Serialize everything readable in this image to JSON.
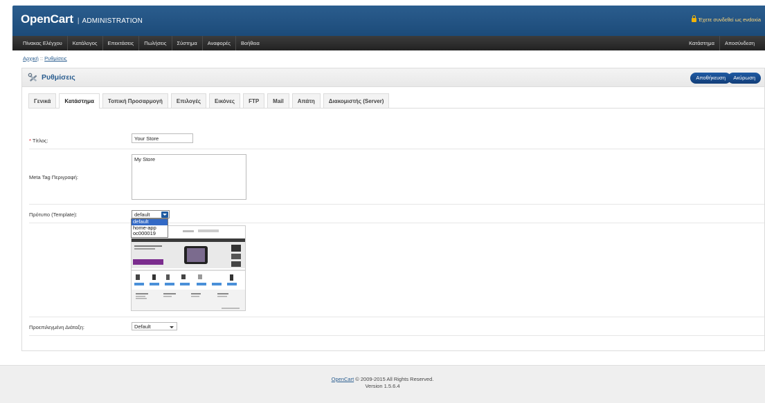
{
  "header": {
    "brand": "OpenCart",
    "separator": "|",
    "admin_label": "ADMINISTRATION",
    "logged_in_text": "Έχετε συνδεθεί ως evdoxia"
  },
  "menu": {
    "left": [
      "Πίνακας Ελέγχου",
      "Κατάλογος",
      "Επεκτάσεις",
      "Πωλήσεις",
      "Σύστημα",
      "Αναφορές",
      "Βοήθεια"
    ],
    "right": [
      "Κατάστημα",
      "Αποσύνδεση"
    ]
  },
  "breadcrumb": {
    "home": "Αρχική",
    "sep": "::",
    "current": "Ρυθμίσεις"
  },
  "box": {
    "title": "Ρυθμίσεις",
    "save_label": "Αποθήκευση",
    "cancel_label": "Ακύρωση"
  },
  "tabs": [
    "Γενικά",
    "Κατάστημα",
    "Τοπική Προσαρμογή",
    "Επιλογές",
    "Εικόνες",
    "FTP",
    "Mail",
    "Απάτη",
    "Διακομιστής (Server)"
  ],
  "active_tab": "Κατάστημα",
  "form": {
    "title": {
      "required_mark": "*",
      "label": "Τίτλος:",
      "value": "Your Store"
    },
    "meta": {
      "label": "Meta Tag Περιγραφή:",
      "value": "My Store"
    },
    "template": {
      "label": "Πρότυπο (Template):",
      "value": "default",
      "options": [
        "default",
        "home-app",
        "oc000019"
      ],
      "selected_option": "default"
    },
    "layout": {
      "label": "Προεπιλεγμένη Διάταξη:",
      "value": "Default"
    }
  },
  "footer": {
    "link": "OpenCart",
    "copyright": "© 2009-2015 All Rights Reserved.",
    "version": "Version 1.5.6.4"
  },
  "colors": {
    "header": "#1f4f80",
    "menu": "#2c2c2c",
    "button": "#1a4d8f",
    "title": "#2a5d8f",
    "required": "#e0141e"
  }
}
